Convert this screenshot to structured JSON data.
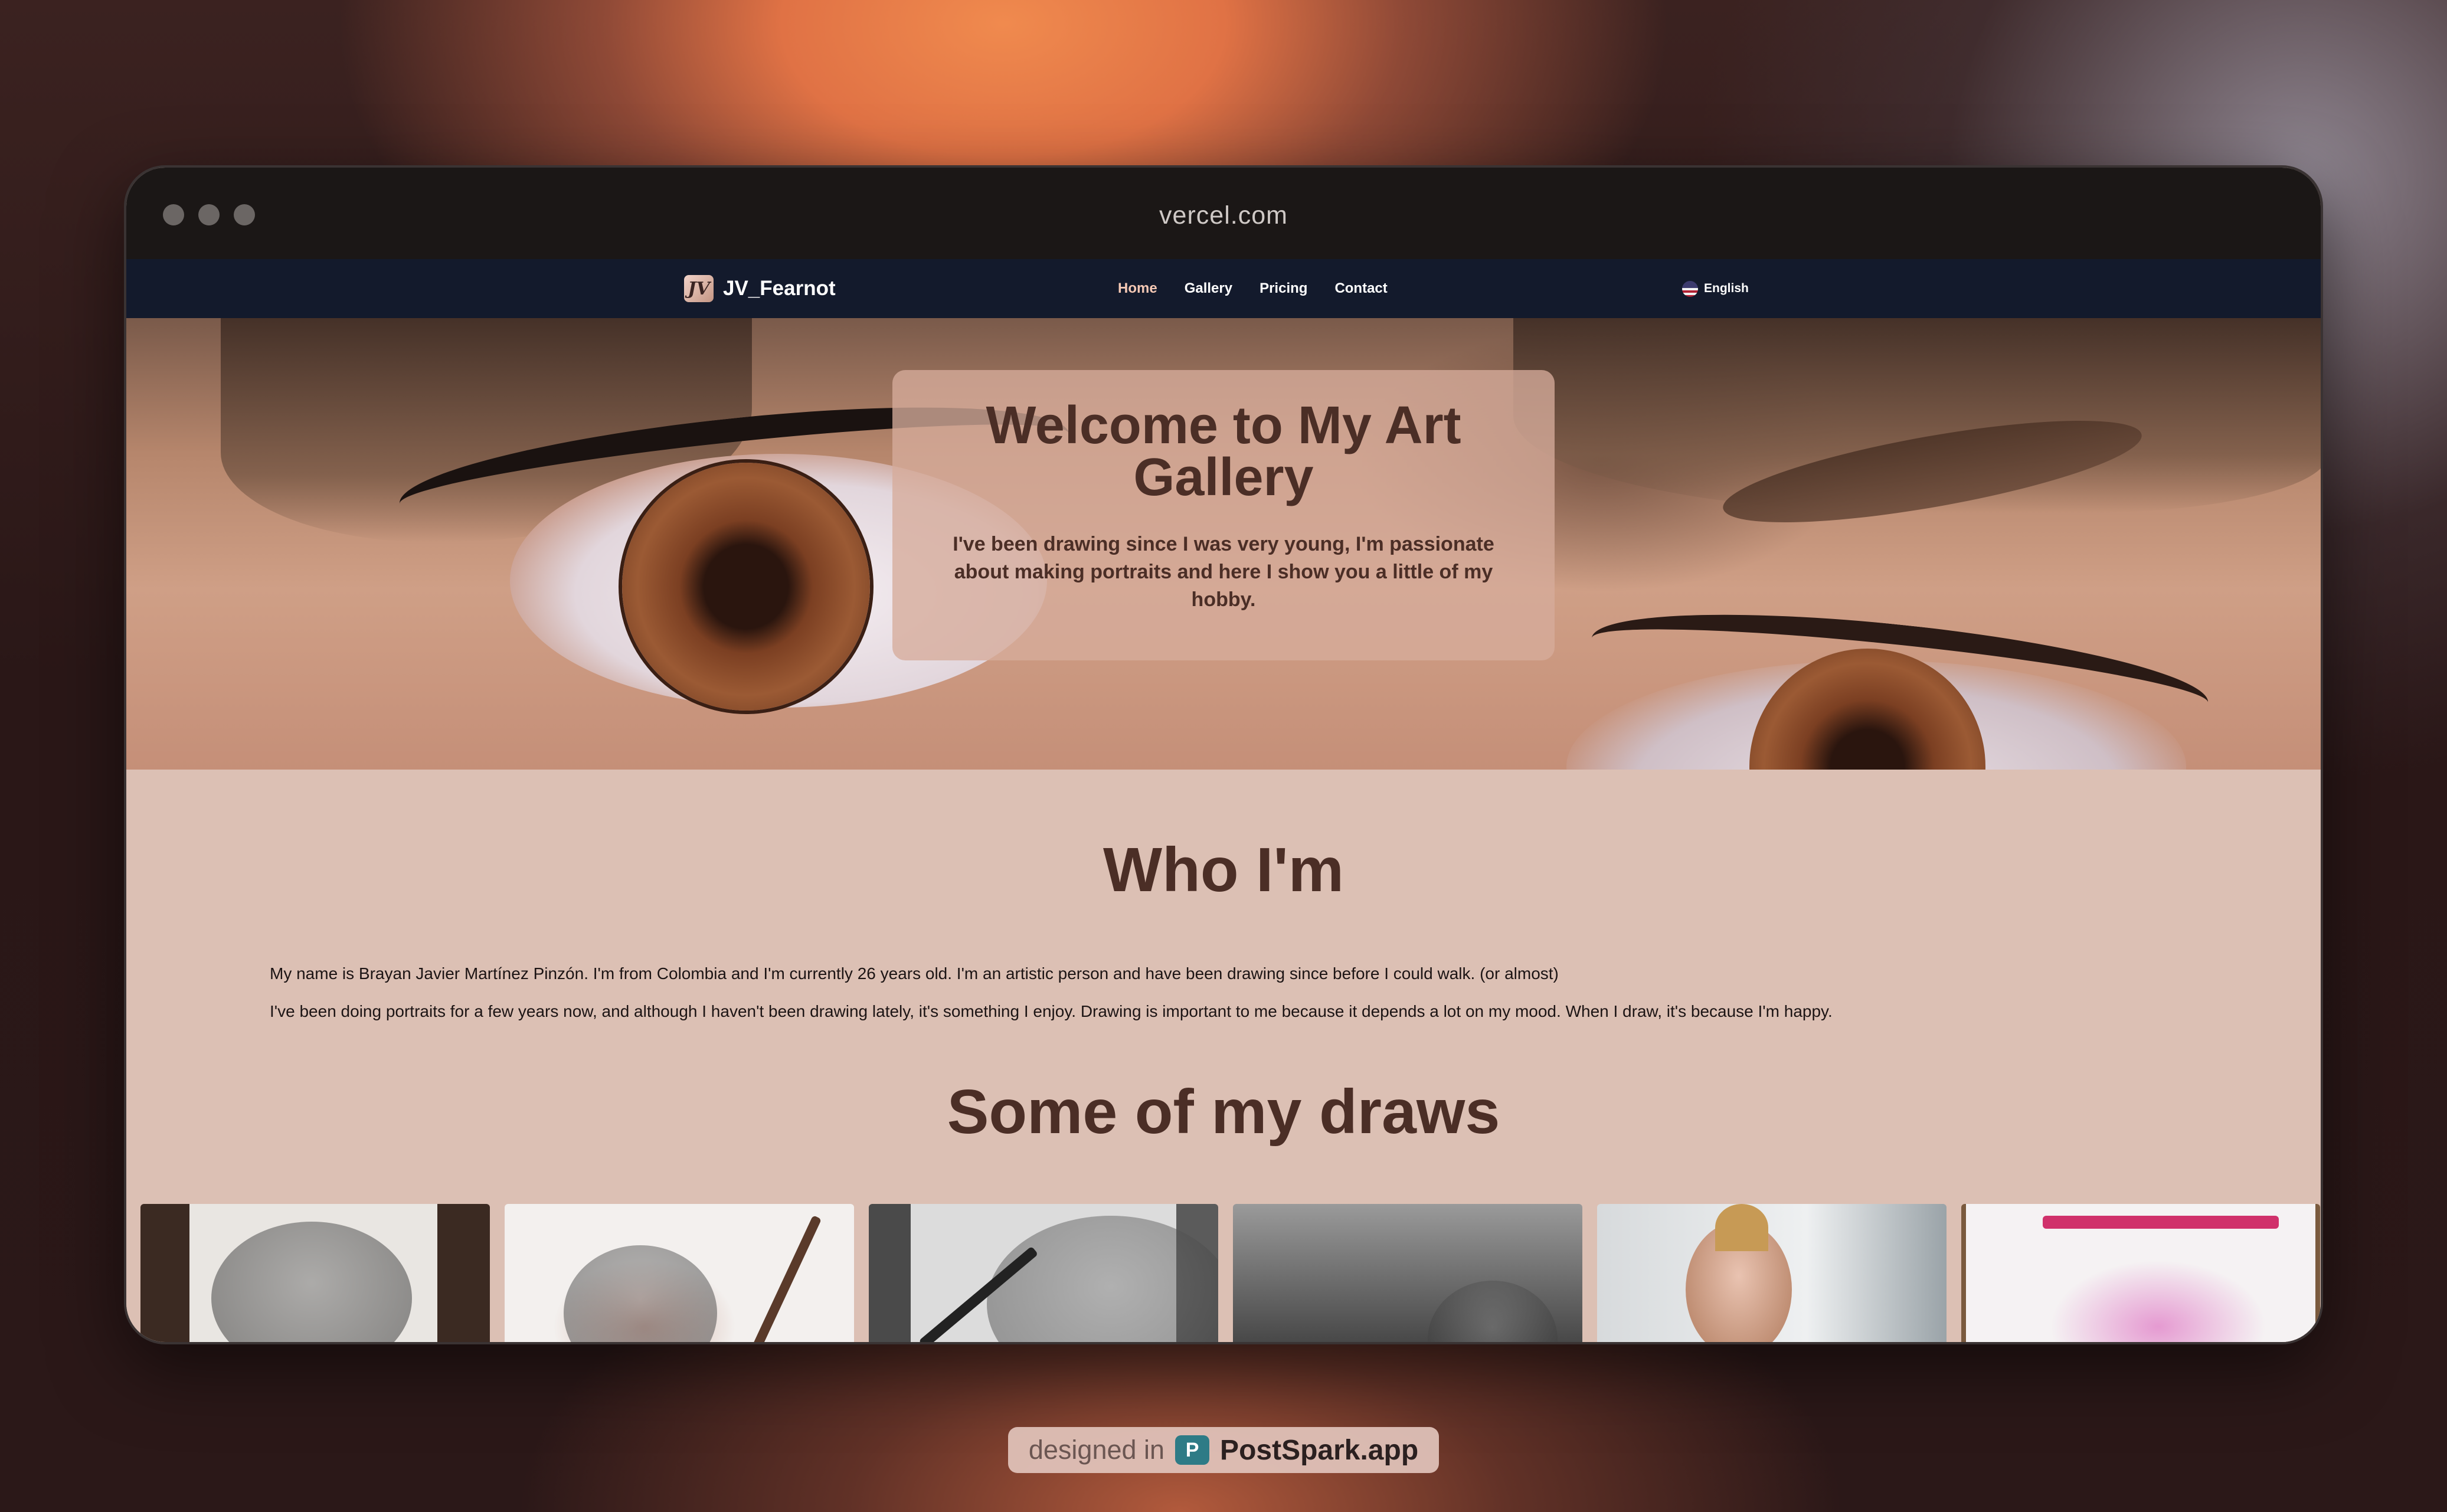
{
  "browser": {
    "url": "vercel.com"
  },
  "navbar": {
    "brand": {
      "logo": "JV",
      "name": "JV_Fearnot"
    },
    "links": [
      {
        "label": "Home",
        "active": true
      },
      {
        "label": "Gallery",
        "active": false
      },
      {
        "label": "Pricing",
        "active": false
      },
      {
        "label": "Contact",
        "active": false
      }
    ],
    "language": {
      "label": "English",
      "icon": "us-flag-icon"
    }
  },
  "hero": {
    "title": "Welcome to My Art Gallery",
    "subtitle": "I've been drawing since I was very young, I'm passionate about making portraits and here I show you a little of my hobby."
  },
  "about": {
    "title": "Who I'm",
    "paragraphs": [
      "My name is Brayan Javier Martínez Pinzón. I'm from Colombia and I'm currently 26 years old. I'm an artistic person and have been drawing since before I could walk. (or almost)",
      "I've been doing portraits for a few years now, and although I haven't been drawing lately, it's something I enjoy. Drawing is important to me because it depends a lot on my mood. When I draw, it's because I'm happy."
    ]
  },
  "gallery": {
    "title": "Some of my draws",
    "items": [
      "drawing-1",
      "drawing-2",
      "drawing-3",
      "drawing-4",
      "drawing-5",
      "drawing-6"
    ]
  },
  "footer_badge": {
    "prefix": "designed in",
    "icon": "postspark-icon",
    "icon_letter": "P",
    "name": "PostSpark.app"
  },
  "colors": {
    "navbar": "#131a2c",
    "page_bg": "#dcc0b4",
    "heading": "#4b2e26",
    "active_link": "#f4c8b4"
  }
}
